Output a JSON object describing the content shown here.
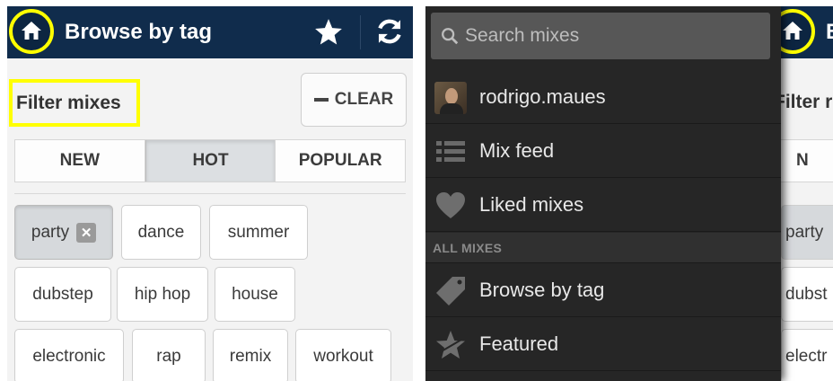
{
  "left": {
    "header": {
      "title": "Browse by tag"
    },
    "filter_label": "Filter mixes",
    "clear_label": "CLEAR",
    "segments": [
      "NEW",
      "HOT",
      "POPULAR"
    ],
    "active_segment": "HOT",
    "tags": [
      {
        "label": "party",
        "selected": true
      },
      {
        "label": "dance",
        "selected": false
      },
      {
        "label": "summer",
        "selected": false
      },
      {
        "label": "dubstep",
        "selected": false
      },
      {
        "label": "hip hop",
        "selected": false
      },
      {
        "label": "house",
        "selected": false
      },
      {
        "label": "electronic",
        "selected": false
      },
      {
        "label": "rap",
        "selected": false
      },
      {
        "label": "remix",
        "selected": false
      },
      {
        "label": "workout",
        "selected": false
      }
    ]
  },
  "right": {
    "search_placeholder": "Search mixes",
    "menu": [
      {
        "label": "rodrigo.maues",
        "icon": "avatar"
      },
      {
        "label": "Mix feed",
        "icon": "list-icon"
      },
      {
        "label": "Liked mixes",
        "icon": "heart-icon"
      }
    ],
    "section_label": "ALL MIXES",
    "menu2": [
      {
        "label": "Browse by tag",
        "icon": "tag-icon"
      },
      {
        "label": "Featured",
        "icon": "star-icon"
      }
    ],
    "peek": {
      "title": "B",
      "filter": "Filter r",
      "seg": "N",
      "tags": [
        "party",
        "dubst",
        "electr"
      ]
    }
  },
  "colors": {
    "appbar": "#102c4c",
    "highlight": "#ffff00",
    "drawer": "#262626"
  }
}
